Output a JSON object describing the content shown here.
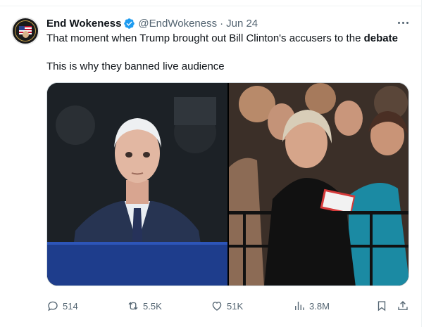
{
  "tweet": {
    "author_name": "End Wokeness",
    "handle": "@EndWokeness",
    "separator": "·",
    "date": "Jun 24",
    "text_line1_plain": "That moment when Trump brought out Bill Clinton's accusers to the ",
    "text_line1_bold": "debate",
    "text_line2": "This is why they banned live audience"
  },
  "actions": {
    "replies": "514",
    "reposts": "5.5K",
    "likes": "51K",
    "views": "3.8M"
  },
  "colors": {
    "text": "#0f1419",
    "secondary": "#536471",
    "verified": "#1d9bf0",
    "border": "#eff3f4"
  },
  "icons": [
    "verified-badge-icon",
    "more-icon",
    "reply-icon",
    "repost-icon",
    "like-icon",
    "views-icon",
    "bookmark-icon",
    "share-icon"
  ]
}
